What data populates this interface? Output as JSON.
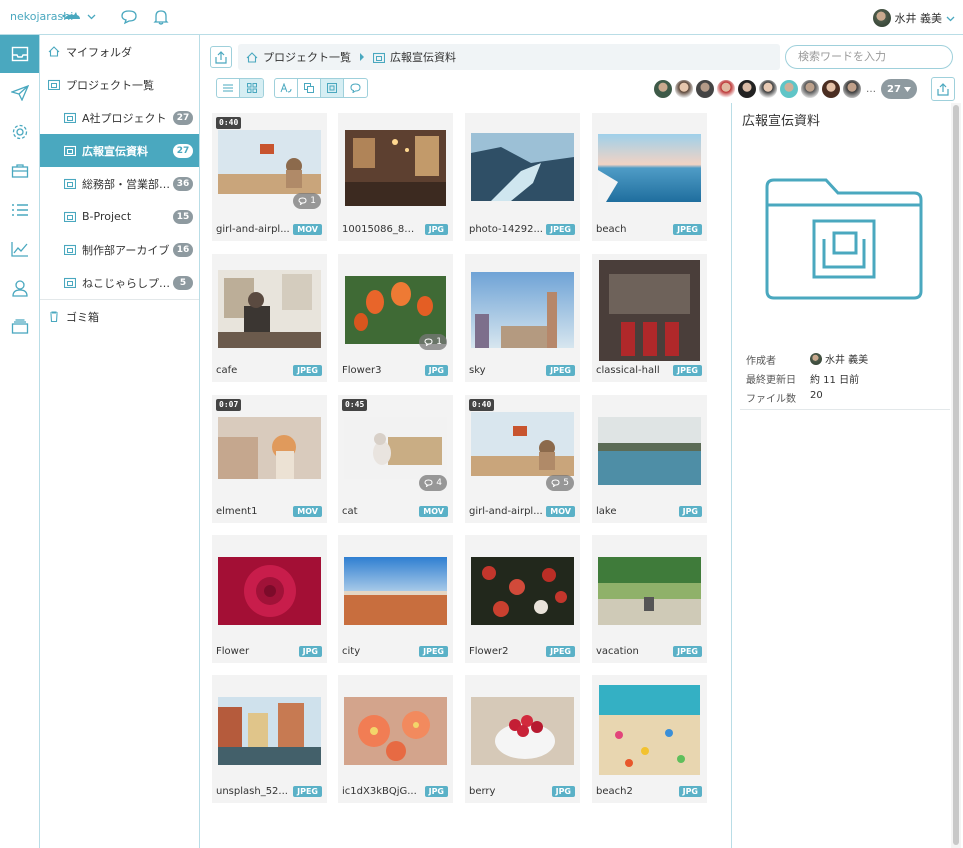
{
  "app": {
    "brand": "nekojarashi",
    "user_name": "水井 義美"
  },
  "rail": {
    "items": [
      {
        "name": "inbox-icon"
      },
      {
        "name": "send-icon"
      },
      {
        "name": "gear-icon"
      },
      {
        "name": "briefcase-icon"
      },
      {
        "name": "list-icon"
      },
      {
        "name": "chart-icon"
      },
      {
        "name": "user-icon"
      },
      {
        "name": "cards-icon"
      }
    ]
  },
  "tree": {
    "my_folder": "マイフォルダ",
    "projects": "プロジェクト一覧",
    "items": [
      {
        "label": "A社プロジェクト",
        "count": "27"
      },
      {
        "label": "広報宣伝資料",
        "count": "27"
      },
      {
        "label": "総務部・営業部共有",
        "count": "36"
      },
      {
        "label": "B-Project",
        "count": "15"
      },
      {
        "label": "制作部アーカイブ",
        "count": "16"
      },
      {
        "label": "ねこじゃらしプロジェクト",
        "count": "5"
      }
    ],
    "trash": "ゴミ箱"
  },
  "breadcrumb": {
    "root": "プロジェクト一覧",
    "current": "広報宣伝資料"
  },
  "search": {
    "placeholder": "検索ワードを入力"
  },
  "members": {
    "count": "27",
    "more": "…"
  },
  "files": [
    {
      "name": "girl-and-airpl...",
      "type": "MOV",
      "duration": "0:40",
      "comments": "1"
    },
    {
      "name": "10015086_81...",
      "type": "JPG"
    },
    {
      "name": "photo-14292...",
      "type": "JPEG"
    },
    {
      "name": "beach",
      "type": "JPEG"
    },
    {
      "name": "cafe",
      "type": "JPEG"
    },
    {
      "name": "Flower3",
      "type": "JPG",
      "comments": "1"
    },
    {
      "name": "sky",
      "type": "JPEG"
    },
    {
      "name": "classical-hall",
      "type": "JPEG"
    },
    {
      "name": "elment1",
      "type": "MOV",
      "duration": "0:07"
    },
    {
      "name": "cat",
      "type": "MOV",
      "duration": "0:45",
      "comments": "4"
    },
    {
      "name": "girl-and-airpl...",
      "type": "MOV",
      "duration": "0:40",
      "comments": "5"
    },
    {
      "name": "lake",
      "type": "JPG"
    },
    {
      "name": "Flower",
      "type": "JPG"
    },
    {
      "name": "city",
      "type": "JPEG"
    },
    {
      "name": "Flower2",
      "type": "JPEG"
    },
    {
      "name": "vacation",
      "type": "JPEG"
    },
    {
      "name": "unsplash_52...",
      "type": "JPEG"
    },
    {
      "name": "ic1dX3kBQjG...",
      "type": "JPG"
    },
    {
      "name": "berry",
      "type": "JPG"
    },
    {
      "name": "beach2",
      "type": "JPG"
    }
  ],
  "detail": {
    "title": "広報宣伝資料",
    "creator_label": "作成者",
    "creator": "水井 義美",
    "updated_label": "最終更新日",
    "updated": "約 11 日前",
    "files_label": "ファイル数",
    "files": "20"
  },
  "colors": {
    "accent": "#4aa8bf",
    "badge": "#8e9aa0",
    "type_tag": "#5ab1c7"
  }
}
